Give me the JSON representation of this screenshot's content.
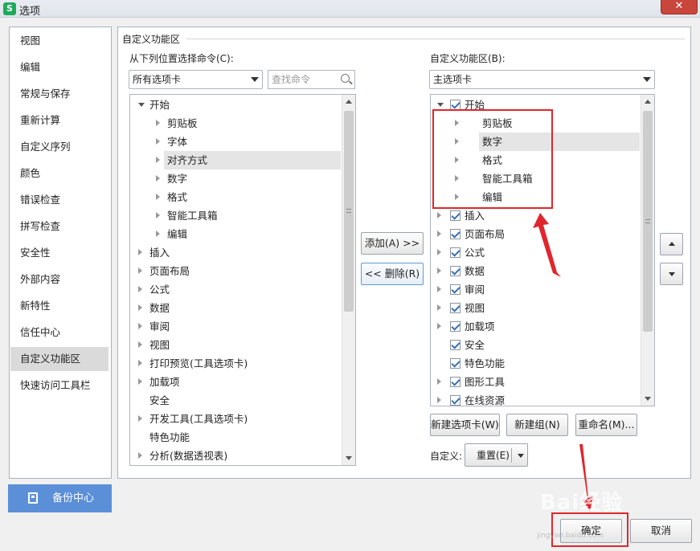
{
  "window": {
    "title": "选项",
    "app_icon": "S",
    "close": "✕"
  },
  "sidebar": {
    "items": [
      {
        "label": "视图"
      },
      {
        "label": "编辑"
      },
      {
        "label": "常规与保存"
      },
      {
        "label": "重新计算"
      },
      {
        "label": "自定义序列"
      },
      {
        "label": "颜色"
      },
      {
        "label": "错误检查"
      },
      {
        "label": "拼写检查"
      },
      {
        "label": "安全性"
      },
      {
        "label": "外部内容"
      },
      {
        "label": "新特性"
      },
      {
        "label": "信任中心"
      },
      {
        "label": "自定义功能区",
        "selected": true
      },
      {
        "label": "快速访问工具栏"
      }
    ],
    "backup_label": "备份中心"
  },
  "main": {
    "group_title": "自定义功能区",
    "left": {
      "label": "从下列位置选择命令(C):",
      "combo_value": "所有选项卡",
      "search_placeholder": "查找命令",
      "tree": [
        {
          "label": "开始",
          "level": 0,
          "expanded": true
        },
        {
          "label": "剪贴板",
          "level": 1
        },
        {
          "label": "字体",
          "level": 1
        },
        {
          "label": "对齐方式",
          "level": 1,
          "highlighted": true
        },
        {
          "label": "数字",
          "level": 1
        },
        {
          "label": "格式",
          "level": 1
        },
        {
          "label": "智能工具箱",
          "level": 1
        },
        {
          "label": "编辑",
          "level": 1
        },
        {
          "label": "插入",
          "level": 0
        },
        {
          "label": "页面布局",
          "level": 0
        },
        {
          "label": "公式",
          "level": 0
        },
        {
          "label": "数据",
          "level": 0
        },
        {
          "label": "审阅",
          "level": 0
        },
        {
          "label": "视图",
          "level": 0
        },
        {
          "label": "打印预览(工具选项卡)",
          "level": 0
        },
        {
          "label": "加载项",
          "level": 0
        },
        {
          "label": "安全",
          "level": 0,
          "no_arrow": true
        },
        {
          "label": "开发工具(工具选项卡)",
          "level": 0
        },
        {
          "label": "特色功能",
          "level": 0,
          "no_arrow": true
        },
        {
          "label": "分析(数据透视表)",
          "level": 0
        }
      ]
    },
    "add_button": "添加(A) >>",
    "remove_button": "<< 删除(R)",
    "right": {
      "label": "自定义功能区(B):",
      "combo_value": "主选项卡",
      "tree": [
        {
          "label": "开始",
          "level": 0,
          "expanded": true,
          "checked": true
        },
        {
          "label": "剪贴板",
          "level": 1
        },
        {
          "label": "数字",
          "level": 1,
          "highlighted": true
        },
        {
          "label": "格式",
          "level": 1
        },
        {
          "label": "智能工具箱",
          "level": 1
        },
        {
          "label": "编辑",
          "level": 1
        },
        {
          "label": "插入",
          "level": 0,
          "checked": true
        },
        {
          "label": "页面布局",
          "level": 0,
          "checked": true
        },
        {
          "label": "公式",
          "level": 0,
          "checked": true
        },
        {
          "label": "数据",
          "level": 0,
          "checked": true
        },
        {
          "label": "审阅",
          "level": 0,
          "checked": true
        },
        {
          "label": "视图",
          "level": 0,
          "checked": true
        },
        {
          "label": "加载项",
          "level": 0,
          "checked": true
        },
        {
          "label": "安全",
          "level": 0,
          "checked": true,
          "no_arrow": true
        },
        {
          "label": "特色功能",
          "level": 0,
          "checked": true,
          "no_arrow": true
        },
        {
          "label": "图形工具",
          "level": 0,
          "checked": true
        },
        {
          "label": "在线资源",
          "level": 0,
          "checked": true
        }
      ],
      "new_tab_button": "新建选项卡(W)",
      "new_group_button": "新建组(N)",
      "rename_button": "重命名(M)...",
      "customize_label": "自定义:",
      "reset_button": "重置(E)"
    }
  },
  "footer": {
    "ok": "确定",
    "cancel": "取消"
  },
  "watermark": {
    "text": "Bai经验",
    "sub": "jingyan.baidu.com"
  },
  "annotation_color": "#e0262c"
}
